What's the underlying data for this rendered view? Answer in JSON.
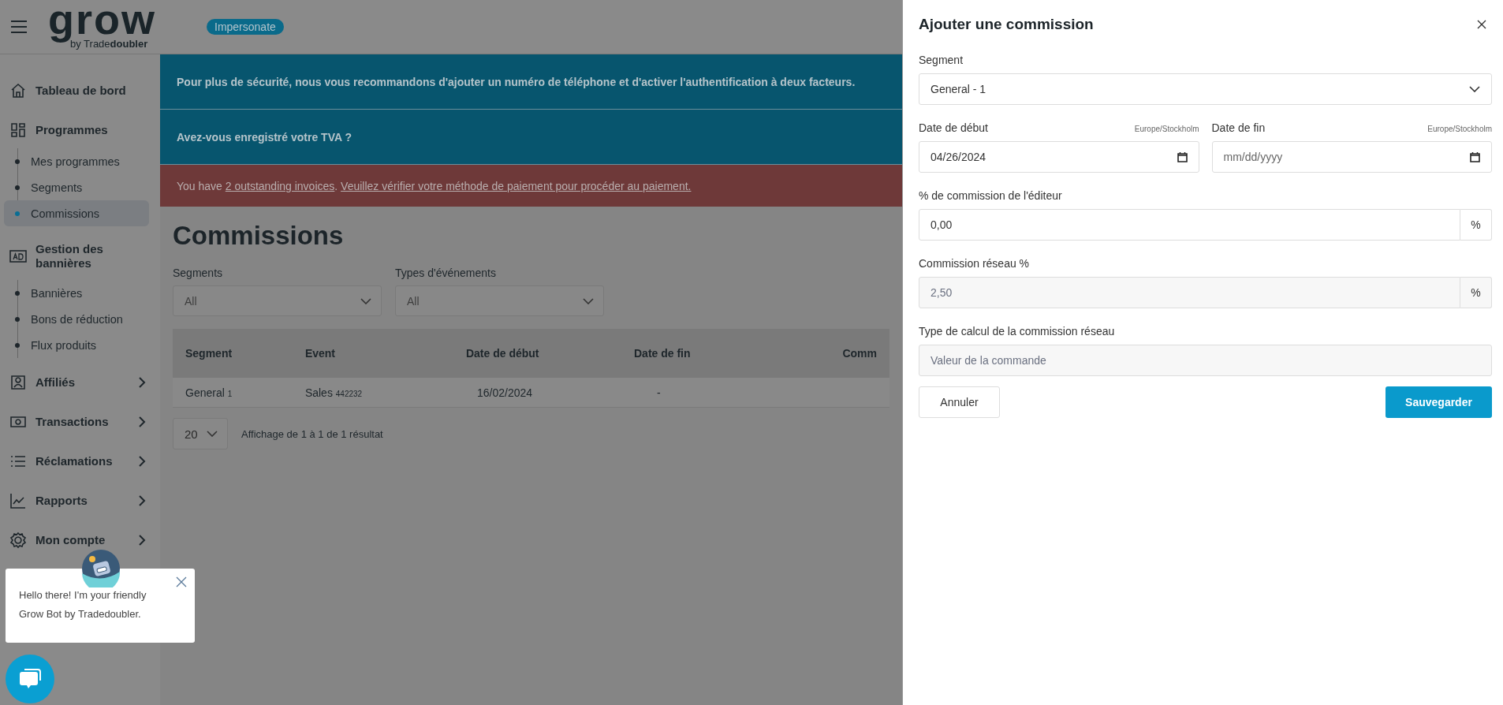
{
  "header": {
    "logo_word": "grow",
    "logo_by": "by Trade**doubler**",
    "impersonate": "Impersonate"
  },
  "sidebar": {
    "items": [
      {
        "label": "Tableau de bord",
        "kind": "link"
      },
      {
        "label": "Programmes",
        "kind": "group",
        "expanded": true,
        "children": [
          {
            "label": "Mes programmes",
            "selected": false
          },
          {
            "label": "Segments",
            "selected": false
          },
          {
            "label": "Commissions",
            "selected": true
          }
        ]
      },
      {
        "label": "Gestion des bannières",
        "kind": "group",
        "expanded": true,
        "children": [
          {
            "label": "Bannières",
            "selected": false
          },
          {
            "label": "Bons de réduction",
            "selected": false
          },
          {
            "label": "Flux produits",
            "selected": false
          }
        ]
      },
      {
        "label": "Affiliés",
        "kind": "group",
        "expanded": false
      },
      {
        "label": "Transactions",
        "kind": "group",
        "expanded": false
      },
      {
        "label": "Réclamations",
        "kind": "group",
        "expanded": false
      },
      {
        "label": "Rapports",
        "kind": "group",
        "expanded": false
      },
      {
        "label": "Mon compte",
        "kind": "group",
        "expanded": false
      }
    ]
  },
  "banners": [
    {
      "kind": "info",
      "text": "Pour plus de sécurité, nous vous recommandons d'ajouter un numéro de téléphone et d'activer l'authentification à deux facteurs."
    },
    {
      "kind": "info",
      "text": "Avez-vous enregistré votre TVA ?"
    },
    {
      "kind": "alert",
      "before": "You have ",
      "link": "2 outstanding invoices",
      "between": ". ",
      "link2": "Veuillez vérifier votre méthode de paiement pour procéder au paiement."
    }
  ],
  "page": {
    "title": "Commissions",
    "filters": [
      {
        "label": "Segments",
        "value": "All"
      },
      {
        "label": "Types d'événements",
        "value": "All"
      }
    ],
    "table": {
      "columns": [
        "Segment",
        "Event",
        "Date de début",
        "Date de fin",
        "Comm"
      ],
      "rows": [
        {
          "segment": "General",
          "segment_id": "1",
          "event": "Sales",
          "event_id": "442232",
          "start": "16/02/2024",
          "end": "-"
        }
      ]
    },
    "page_size": "20",
    "summary": "Affichage de 1 à 1 de 1 résultat"
  },
  "panel": {
    "title": "Ajouter une commission",
    "segment": {
      "label": "Segment",
      "value": "General - 1"
    },
    "start_date": {
      "label": "Date de début",
      "timezone": "Europe/Stockholm",
      "value": "04/26/2024"
    },
    "end_date": {
      "label": "Date de fin",
      "timezone": "Europe/Stockholm",
      "placeholder": "mm/dd/yyyy"
    },
    "publisher_commission": {
      "label": "% de commission de l'éditeur",
      "value": "0,00",
      "unit": "%",
      "disabled": false
    },
    "network_commission": {
      "label": "Commission réseau %",
      "value": "2,50",
      "unit": "%",
      "disabled": true
    },
    "calc_type": {
      "label": "Type de calcul de la commission réseau",
      "placeholder": "Valeur de la commande",
      "disabled": true
    },
    "buttons": {
      "cancel": "Annuler",
      "save": "Sauvegarder"
    }
  },
  "chat": {
    "message": "Hello there! I'm your friendly Grow Bot by Tradedoubler."
  }
}
